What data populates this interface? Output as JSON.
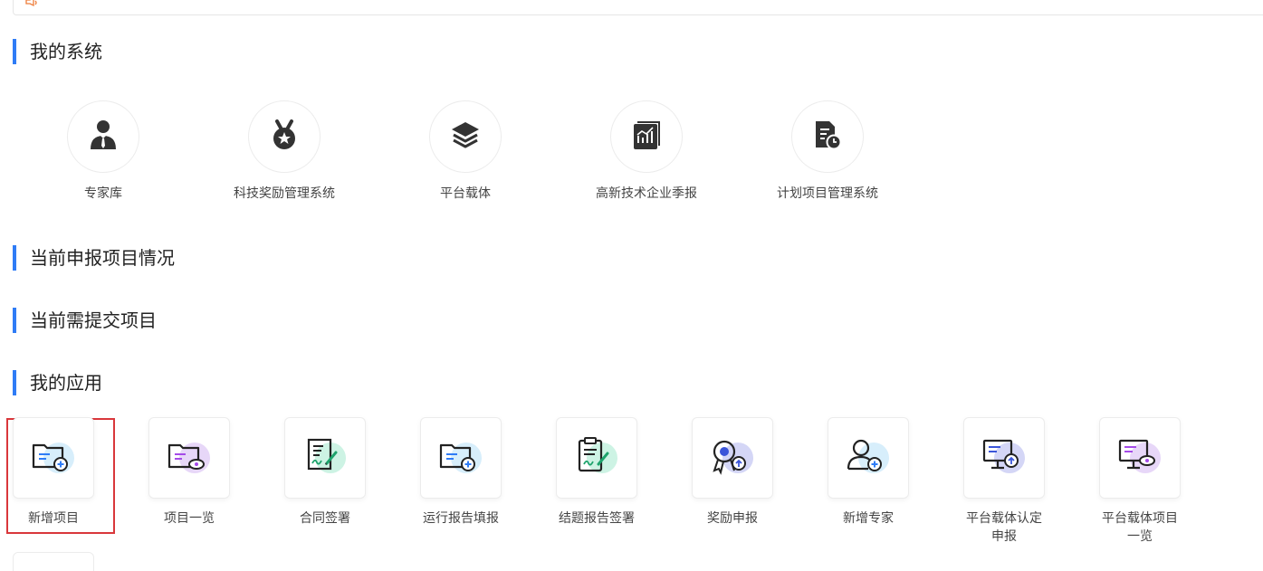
{
  "sections": {
    "my_systems": "我的系统",
    "current_projects": "当前申报项目情况",
    "pending_submit": "当前需提交项目",
    "my_apps": "我的应用"
  },
  "systems": [
    {
      "label": "专家库",
      "icon": "expert-person-icon"
    },
    {
      "label": "科技奖励管理系统",
      "icon": "award-medal-icon"
    },
    {
      "label": "平台载体",
      "icon": "layers-stack-icon"
    },
    {
      "label": "高新技术企业季报",
      "icon": "chart-report-icon"
    },
    {
      "label": "计划项目管理系统",
      "icon": "document-clock-icon"
    }
  ],
  "apps": [
    {
      "label": "新增项目",
      "icon": "folder-add-icon"
    },
    {
      "label": "项目一览",
      "icon": "folder-view-icon"
    },
    {
      "label": "合同签署",
      "icon": "contract-sign-icon"
    },
    {
      "label": "运行报告填报",
      "icon": "folder-report-icon"
    },
    {
      "label": "结题报告签署",
      "icon": "clipboard-sign-icon"
    },
    {
      "label": "奖励申报",
      "icon": "award-upload-icon"
    },
    {
      "label": "新增专家",
      "icon": "user-add-icon"
    },
    {
      "label": "平台载体认定申报",
      "icon": "monitor-upload-icon"
    },
    {
      "label": "平台载体项目一览",
      "icon": "monitor-view-icon"
    }
  ],
  "colors": {
    "accent": "#2f7cf6",
    "selected_border": "#d9373b",
    "notice_icon": "#ee7d3a"
  }
}
